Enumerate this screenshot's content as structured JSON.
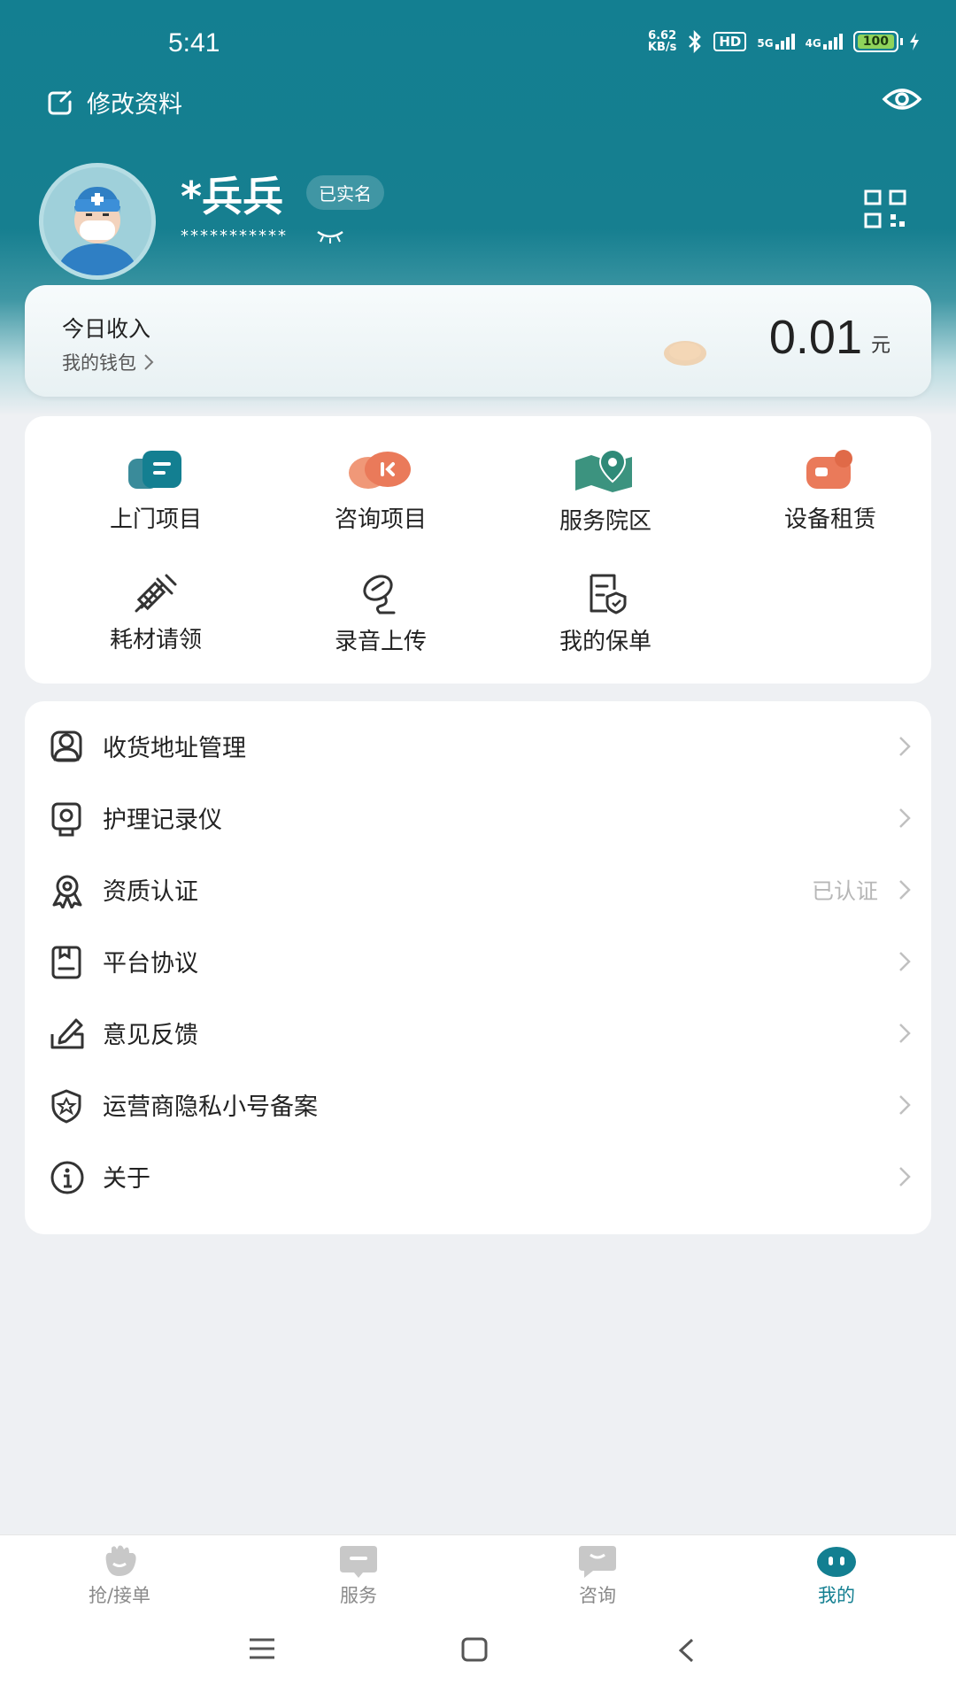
{
  "status_bar": {
    "time": "5:41",
    "net_speed_value": "6.62",
    "net_speed_unit": "KB/s",
    "hd": "HD",
    "sim1": "5G",
    "sim2": "4G",
    "battery": "100"
  },
  "header": {
    "edit_profile": "修改资料",
    "user_name": "*兵兵",
    "verified": "已实名",
    "masked_phone": "***********"
  },
  "income": {
    "title": "今日收入",
    "wallet_link": "我的钱包",
    "amount": "0.01",
    "unit": "元"
  },
  "services": [
    {
      "label": "上门项目",
      "icon": "home-visit-icon",
      "color": "#137f91"
    },
    {
      "label": "咨询项目",
      "icon": "consult-icon",
      "color": "#ea7a5a"
    },
    {
      "label": "服务院区",
      "icon": "hospital-location-icon",
      "color": "#2f8a78"
    },
    {
      "label": "设备租赁",
      "icon": "equipment-rental-icon",
      "color": "#ea7a5a"
    },
    {
      "label": "耗材请领",
      "icon": "syringe-icon",
      "color": "#333333"
    },
    {
      "label": "录音上传",
      "icon": "recording-upload-icon",
      "color": "#333333"
    },
    {
      "label": "我的保单",
      "icon": "insurance-policy-icon",
      "color": "#333333"
    }
  ],
  "menu": [
    {
      "label": "收货地址管理",
      "icon": "address-icon",
      "extra": ""
    },
    {
      "label": "护理记录仪",
      "icon": "recorder-icon",
      "extra": ""
    },
    {
      "label": "资质认证",
      "icon": "certification-icon",
      "extra": "已认证"
    },
    {
      "label": "平台协议",
      "icon": "agreement-icon",
      "extra": ""
    },
    {
      "label": "意见反馈",
      "icon": "feedback-icon",
      "extra": ""
    },
    {
      "label": "运营商隐私小号备案",
      "icon": "privacy-number-icon",
      "extra": ""
    },
    {
      "label": "关于",
      "icon": "about-icon",
      "extra": ""
    }
  ],
  "bottom_nav": [
    {
      "label": "抢/接单",
      "icon": "grab-order-icon",
      "active": false
    },
    {
      "label": "服务",
      "icon": "service-icon",
      "active": false
    },
    {
      "label": "咨询",
      "icon": "consult-nav-icon",
      "active": false
    },
    {
      "label": "我的",
      "icon": "profile-icon",
      "active": true
    }
  ],
  "colors": {
    "primary": "#137f91",
    "accent": "#ea7a5a",
    "background": "#eef0f3"
  }
}
